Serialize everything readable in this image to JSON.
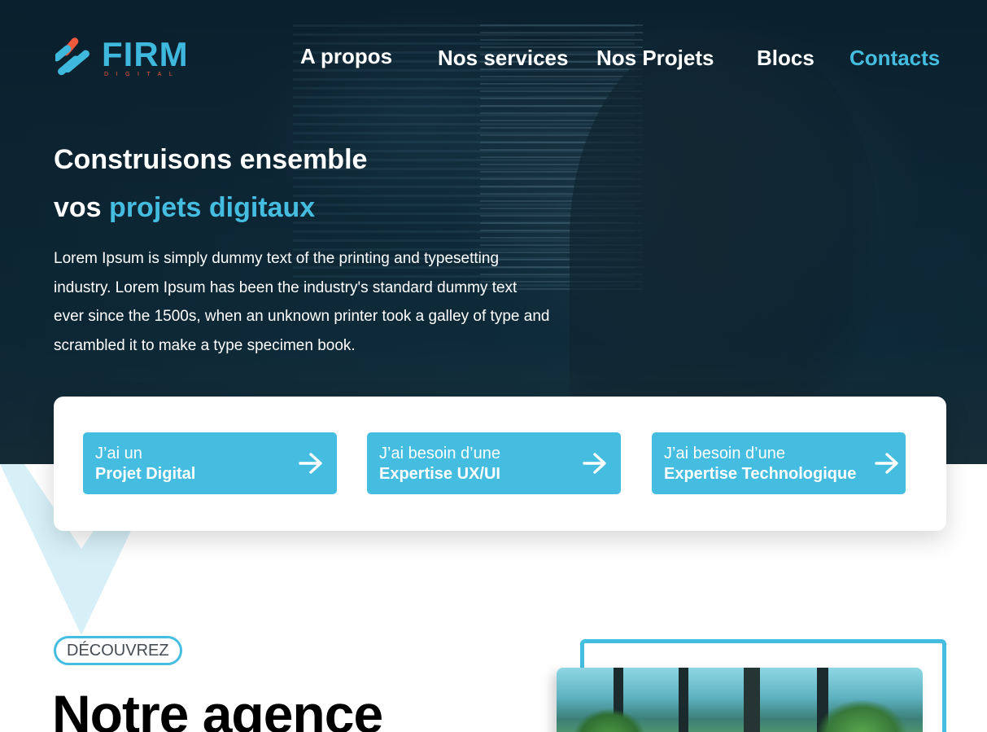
{
  "brand": {
    "name": "FIRM",
    "tagline": "DIGITAL",
    "primary_color": "#45bde0",
    "accent_color": "#ef5a3c"
  },
  "nav": {
    "items": [
      {
        "label": "A propos",
        "active": false
      },
      {
        "label": "Nos services",
        "active": false
      },
      {
        "label": "Nos Projets",
        "active": false
      },
      {
        "label": "Blocs",
        "active": false
      },
      {
        "label": "Contacts",
        "active": true
      }
    ]
  },
  "hero": {
    "title_line1": "Construisons ensemble",
    "title_line2_prefix": "vos",
    "title_line2_accent": "projets digitaux",
    "paragraph": "Lorem Ipsum is simply dummy text of the printing and typesetting industry. Lorem Ipsum has been the industry's standard dummy text ever since the 1500s, when an unknown printer took a galley of type and scrambled it to make a type specimen book."
  },
  "cta": {
    "buttons": [
      {
        "line1": "J’ai un",
        "line2": "Projet Digital",
        "icon": "arrow-right-icon"
      },
      {
        "line1": "J’ai besoin d’une",
        "line2": "Expertise UX/UI",
        "icon": "arrow-right-icon"
      },
      {
        "line1": "J’ai besoin d’une",
        "line2": "Expertise Technologique",
        "icon": "arrow-right-icon"
      }
    ]
  },
  "discover": {
    "badge": "DÉCOUVREZ",
    "title_regular": "Notre",
    "title_bold": "agence"
  }
}
